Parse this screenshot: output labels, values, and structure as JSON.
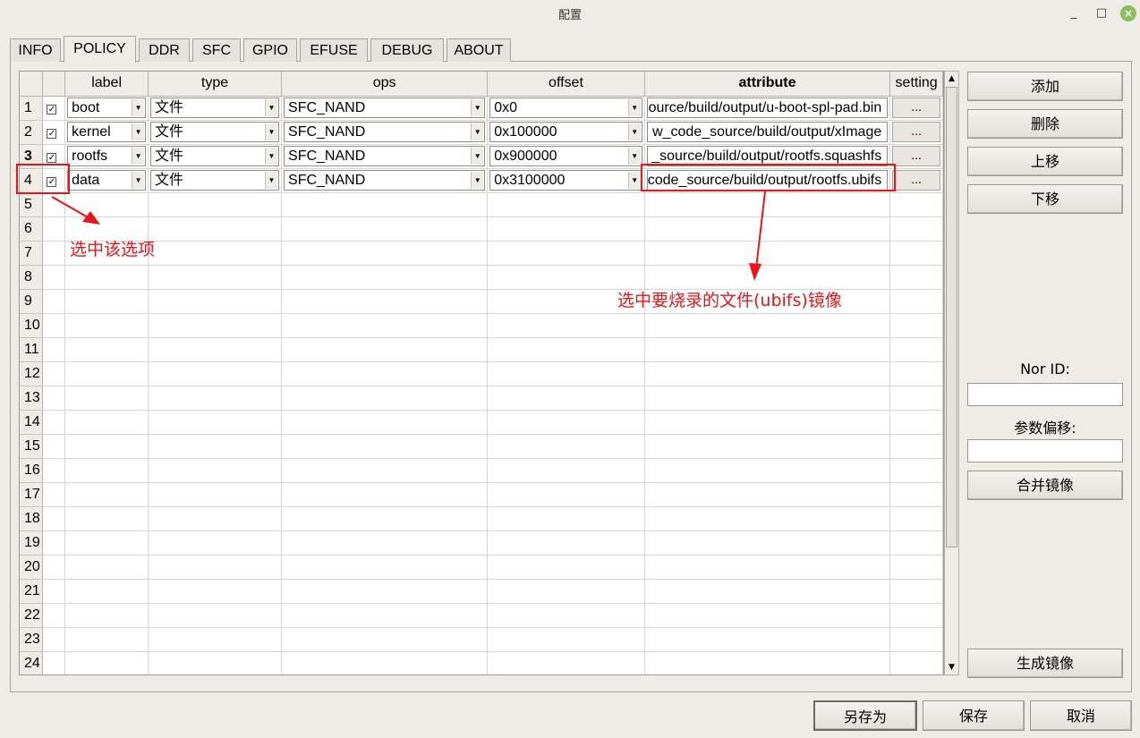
{
  "window": {
    "title": "配置",
    "min_icon": "minimize-icon",
    "max_icon": "maximize-icon",
    "close_icon": "close-icon"
  },
  "tabs": [
    {
      "label": "INFO",
      "active": false
    },
    {
      "label": "POLICY",
      "active": true
    },
    {
      "label": "DDR",
      "active": false
    },
    {
      "label": "SFC",
      "active": false
    },
    {
      "label": "GPIO",
      "active": false
    },
    {
      "label": "EFUSE",
      "active": false
    },
    {
      "label": "DEBUG",
      "active": false
    },
    {
      "label": "ABOUT",
      "active": false
    }
  ],
  "table": {
    "columns": [
      "",
      "label",
      "type",
      "ops",
      "offset",
      "attribute",
      "setting"
    ],
    "rows": [
      {
        "num": "1",
        "checked": true,
        "label": "boot",
        "type": "文件",
        "ops": "SFC_NAND",
        "offset": "0x0",
        "attribute": "ource/build/output/u-boot-spl-pad.bin",
        "setting": "..."
      },
      {
        "num": "2",
        "checked": true,
        "label": "kernel",
        "type": "文件",
        "ops": "SFC_NAND",
        "offset": "0x100000",
        "attribute": "w_code_source/build/output/xImage",
        "setting": "..."
      },
      {
        "num": "3",
        "checked": true,
        "label": "rootfs",
        "type": "文件",
        "ops": "SFC_NAND",
        "offset": "0x900000",
        "attribute": "_source/build/output/rootfs.squashfs",
        "setting": "..."
      },
      {
        "num": "4",
        "checked": true,
        "label": "data",
        "type": "文件",
        "ops": "SFC_NAND",
        "offset": "0x3100000",
        "attribute": "code_source/build/output/rootfs.ubifs",
        "setting": "..."
      }
    ],
    "empty_rows": [
      "5",
      "6",
      "7",
      "8",
      "9",
      "10",
      "11",
      "12",
      "13",
      "14",
      "15",
      "16",
      "17",
      "18",
      "19",
      "20",
      "21",
      "22",
      "23",
      "24"
    ]
  },
  "right_panel": {
    "add": "添加",
    "delete": "删除",
    "move_up": "上移",
    "move_down": "下移",
    "nor_id_label": "Nor ID:",
    "nor_id_value": "",
    "param_offset_label": "参数偏移:",
    "param_offset_value": "",
    "merge_image": "合并镜像",
    "generate_image": "生成镜像"
  },
  "bottom": {
    "save_as": "另存为",
    "save": "保存",
    "cancel": "取消"
  },
  "annotations": {
    "select_option": "选中该选项",
    "select_file": "选中要烧录的文件(ubifs)镜像",
    "color": "#e8151b"
  }
}
